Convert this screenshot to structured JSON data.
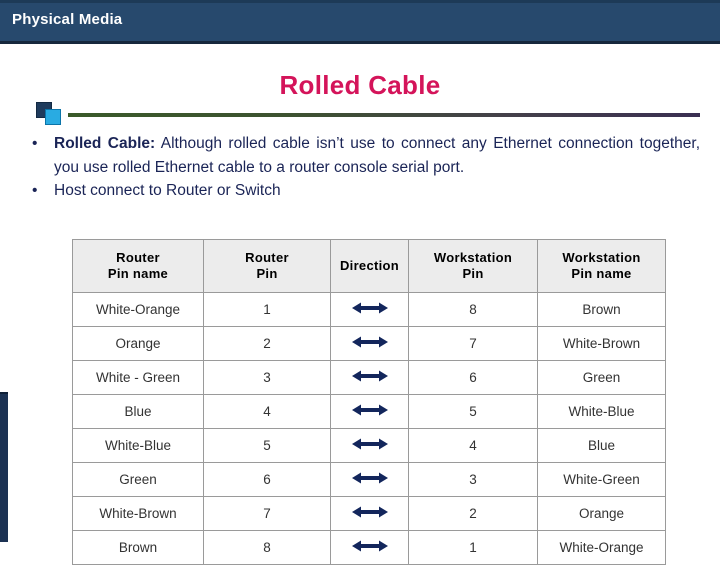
{
  "header": {
    "section_title": "Physical Media",
    "bar_color": "#27496d"
  },
  "slide": {
    "title": "Rolled Cable",
    "title_color": "#d4145a",
    "rule_color": "#3a5a2a",
    "accent_square_dark": "#1f3b5c",
    "accent_square_light": "#29abe2"
  },
  "bullets": [
    {
      "marker": "•",
      "lead": "Rolled Cable:",
      "text": " Although rolled cable isn’t use to connect any Ethernet connection together, you use rolled Ethernet cable to a router console serial port."
    },
    {
      "marker": "•",
      "lead": "",
      "text": "Host connect to Router or Switch"
    }
  ],
  "table": {
    "headers": [
      "Router\nPin name",
      "Router\nPin",
      "Direction",
      "Workstation\nPin",
      "Workstation\nPin name"
    ],
    "headers_lines": [
      [
        "Router",
        "Pin name"
      ],
      [
        "Router",
        "Pin"
      ],
      [
        "Direction",
        ""
      ],
      [
        "Workstation",
        "Pin"
      ],
      [
        "Workstation",
        "Pin name"
      ]
    ],
    "direction_symbol": "↔",
    "direction_color": "#13265c",
    "rows": [
      {
        "router_pin_name": "White-Orange",
        "router_pin": "1",
        "direction": "↔",
        "workstation_pin": "8",
        "workstation_pin_name": "Brown"
      },
      {
        "router_pin_name": "Orange",
        "router_pin": "2",
        "direction": "↔",
        "workstation_pin": "7",
        "workstation_pin_name": "White-Brown"
      },
      {
        "router_pin_name": "White - Green",
        "router_pin": "3",
        "direction": "↔",
        "workstation_pin": "6",
        "workstation_pin_name": "Green"
      },
      {
        "router_pin_name": "Blue",
        "router_pin": "4",
        "direction": "↔",
        "workstation_pin": "5",
        "workstation_pin_name": "White-Blue"
      },
      {
        "router_pin_name": "White-Blue",
        "router_pin": "5",
        "direction": "↔",
        "workstation_pin": "4",
        "workstation_pin_name": "Blue"
      },
      {
        "router_pin_name": "Green",
        "router_pin": "6",
        "direction": "↔",
        "workstation_pin": "3",
        "workstation_pin_name": "White-Green"
      },
      {
        "router_pin_name": "White-Brown",
        "router_pin": "7",
        "direction": "↔",
        "workstation_pin": "2",
        "workstation_pin_name": "Orange"
      },
      {
        "router_pin_name": "Brown",
        "router_pin": "8",
        "direction": "↔",
        "workstation_pin": "1",
        "workstation_pin_name": "White-Orange"
      }
    ]
  }
}
